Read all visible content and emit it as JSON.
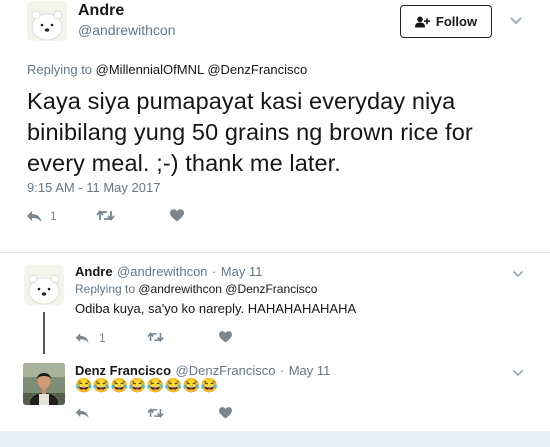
{
  "main_tweet": {
    "author_name": "Andre",
    "author_handle": "@andrewithcon",
    "follow_label": "Follow",
    "replying_prefix": "Replying to ",
    "replying_to": "@MillennialOfMNL @DenzFrancisco",
    "text": "Kaya siya pumapayat kasi everyday niya binibilang yung 50 grains ng brown rice for every meal. ;-) thank me later.",
    "timestamp": "9:15 AM - 11 May 2017",
    "reply_count": "1",
    "icons": [
      "reply-icon",
      "retweet-icon",
      "like-icon",
      "chevron-down-icon",
      "follow-user-icon"
    ]
  },
  "replies": [
    {
      "author_name": "Andre",
      "author_handle": "@andrewithcon",
      "date": "May 11",
      "replying_prefix": "Replying to ",
      "replying_to": "@andrewithcon @DenzFrancisco",
      "text": "Odiba kuya, sa'yo ko nareply. HAHAHAHAHAHA",
      "reply_count": "1"
    },
    {
      "author_name": "Denz Francisco",
      "author_handle": "@DenzFrancisco",
      "date": "May 11",
      "emoji_text": "😂😂😂😂😂😂😂😂"
    }
  ],
  "colors": {
    "text_primary": "#14171a",
    "text_secondary": "#657786",
    "icon_gray": "#7a8790",
    "divider": "#e1e8ed",
    "avatar_bg": "#f4f3ea"
  }
}
